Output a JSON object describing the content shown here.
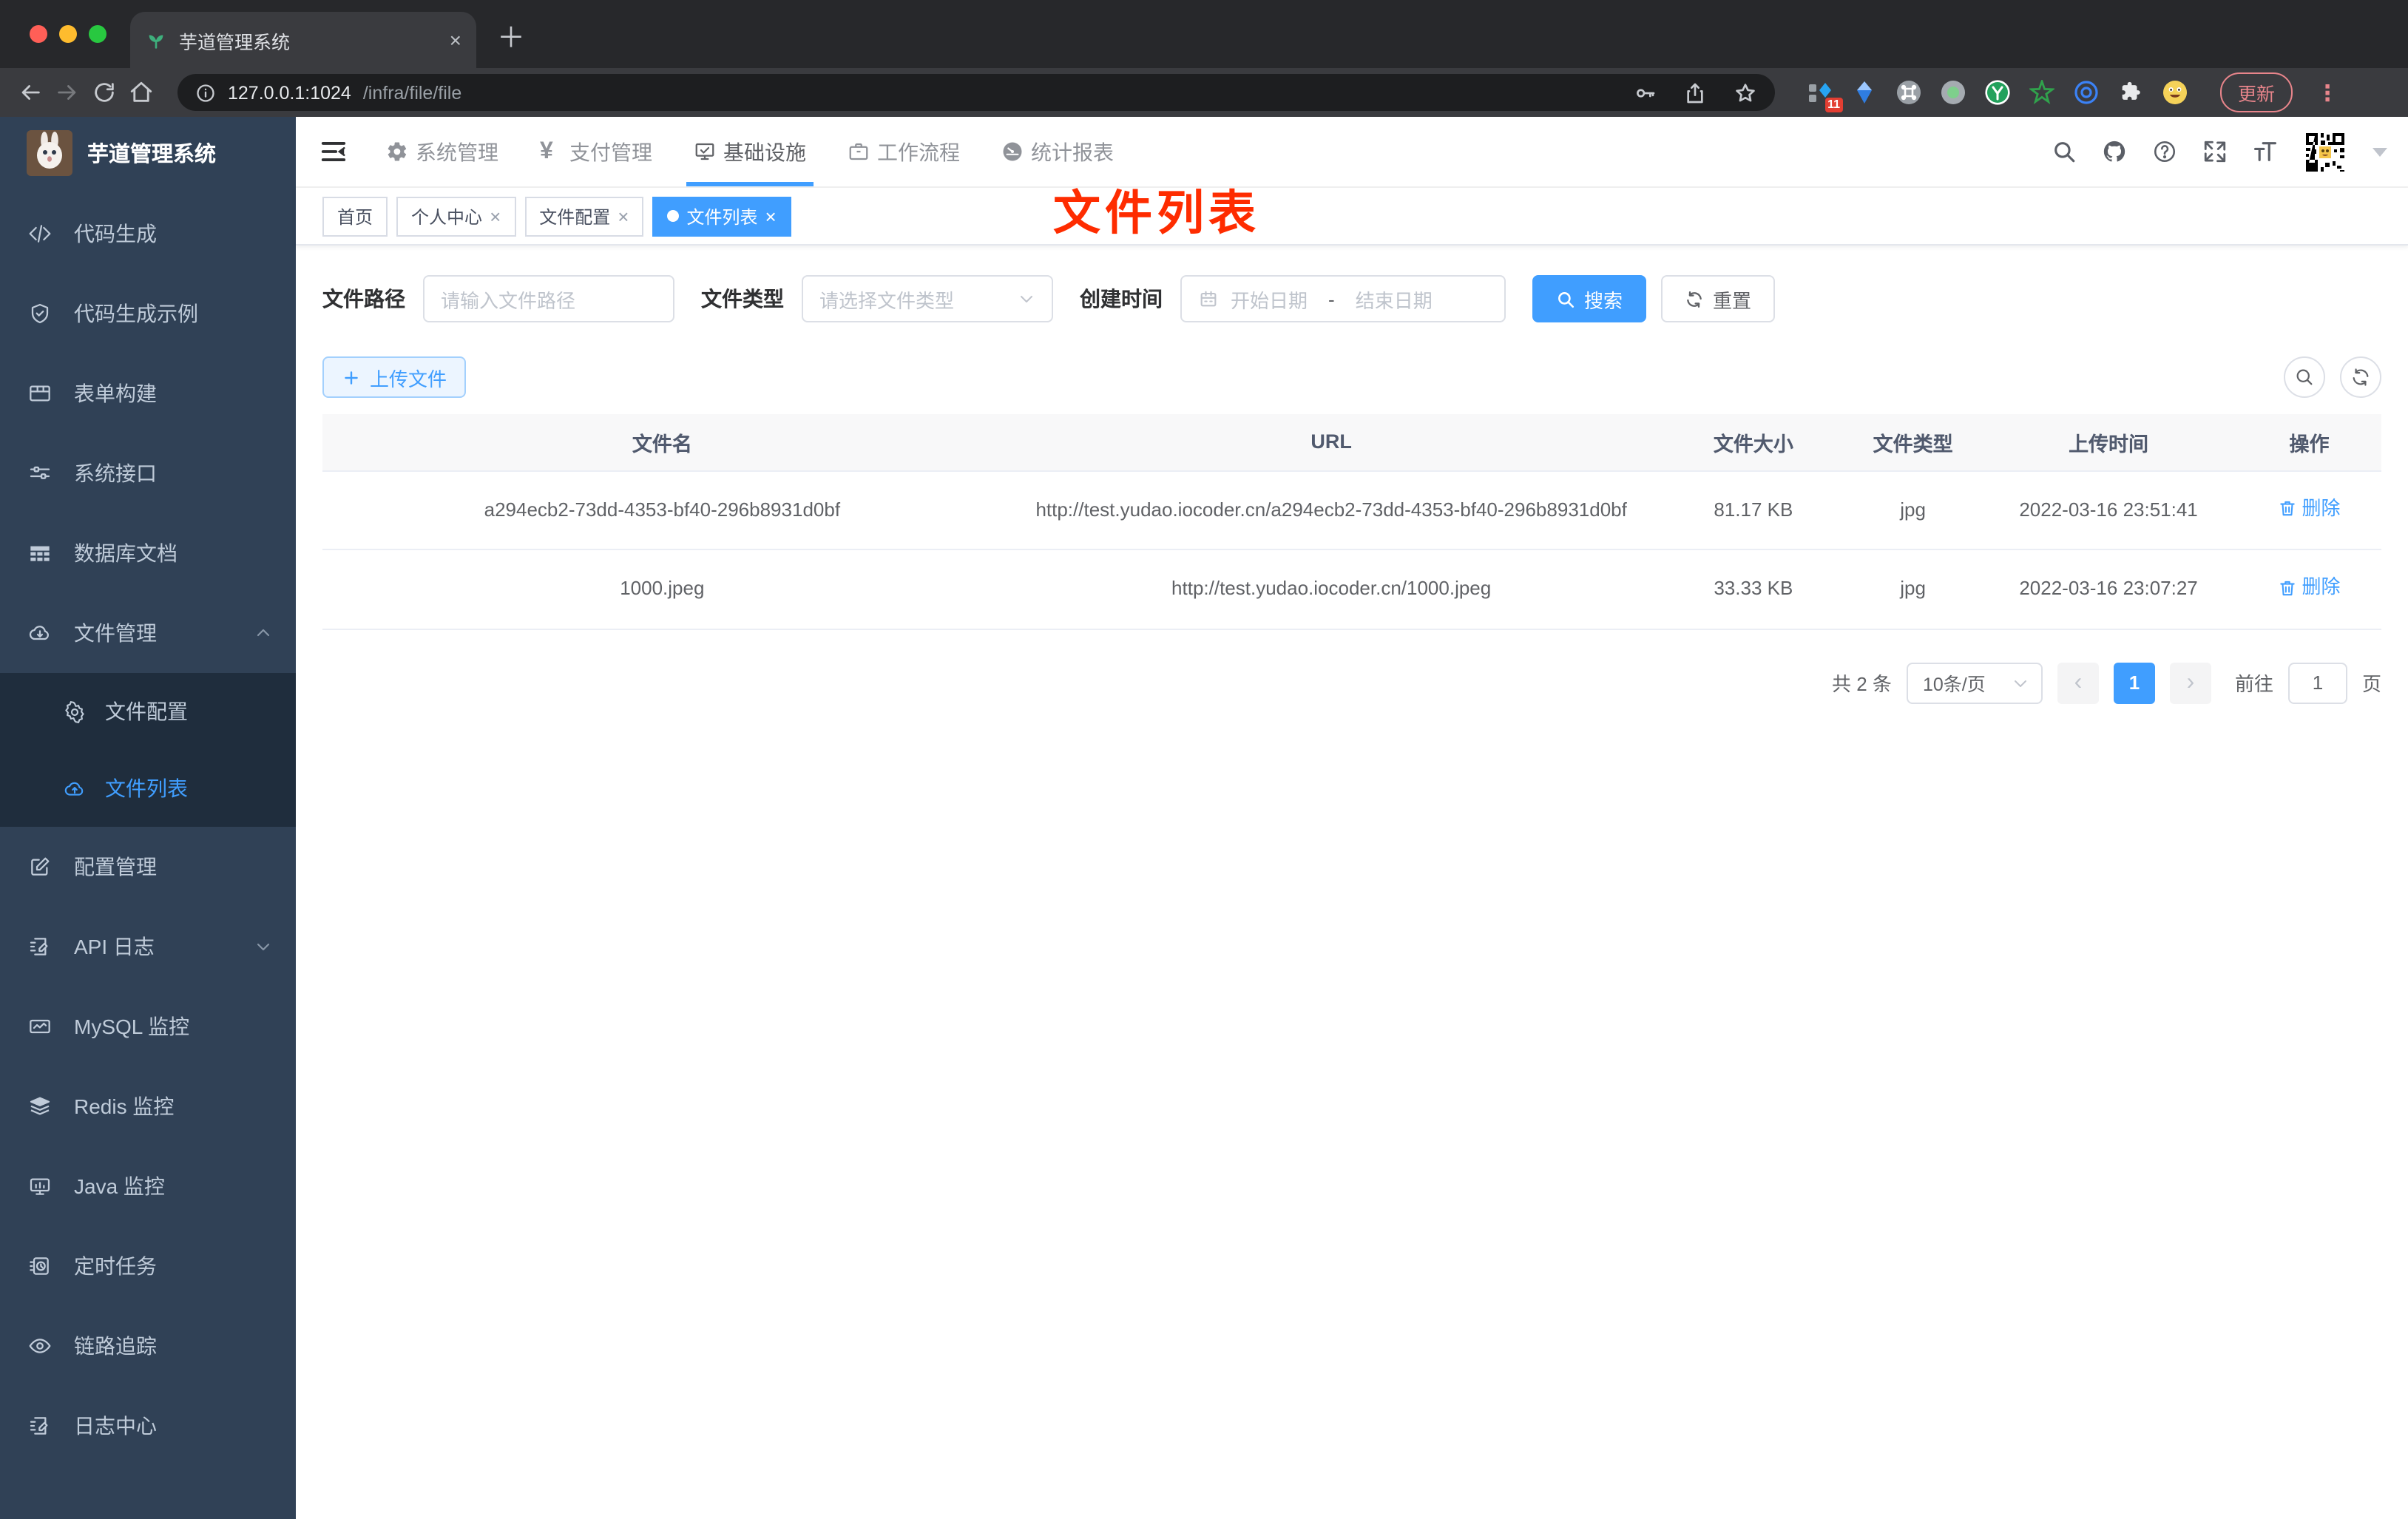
{
  "browser": {
    "tab_title": "芋道管理系统",
    "url_host": "127.0.0.1:1024",
    "url_path": "/infra/file/file",
    "update_label": "更新",
    "extension_badge": "11"
  },
  "header": {
    "nav": [
      {
        "label": "系统管理"
      },
      {
        "label": "支付管理"
      },
      {
        "label": "基础设施"
      },
      {
        "label": "工作流程"
      },
      {
        "label": "统计报表"
      }
    ]
  },
  "sidebar": {
    "title": "芋道管理系统",
    "items": [
      {
        "label": "代码生成"
      },
      {
        "label": "代码生成示例"
      },
      {
        "label": "表单构建"
      },
      {
        "label": "系统接口"
      },
      {
        "label": "数据库文档"
      },
      {
        "label": "文件管理"
      }
    ],
    "sub_items": [
      {
        "label": "文件配置"
      },
      {
        "label": "文件列表"
      }
    ],
    "bottom_items": [
      {
        "label": "配置管理"
      },
      {
        "label": "API 日志"
      },
      {
        "label": "MySQL 监控"
      },
      {
        "label": "Redis 监控"
      },
      {
        "label": "Java 监控"
      },
      {
        "label": "定时任务"
      },
      {
        "label": "链路追踪"
      },
      {
        "label": "日志中心"
      }
    ]
  },
  "tags": [
    {
      "label": "首页"
    },
    {
      "label": "个人中心"
    },
    {
      "label": "文件配置"
    },
    {
      "label": "文件列表"
    }
  ],
  "annotation": {
    "text": "文件列表",
    "color": "#fe2c00"
  },
  "filters": {
    "path_label": "文件路径",
    "path_placeholder": "请输入文件路径",
    "type_label": "文件类型",
    "type_placeholder": "请选择文件类型",
    "date_label": "创建时间",
    "date_start_placeholder": "开始日期",
    "date_separator": "-",
    "date_end_placeholder": "结束日期",
    "search_label": "搜索",
    "reset_label": "重置"
  },
  "toolbar": {
    "upload_label": "上传文件"
  },
  "table": {
    "headers": [
      "文件名",
      "URL",
      "文件大小",
      "文件类型",
      "上传时间",
      "操作"
    ],
    "rows": [
      {
        "name": "a294ecb2-73dd-4353-bf40-296b8931d0bf",
        "url": "http://test.yudao.iocoder.cn/a294ecb2-73dd-4353-bf40-296b8931d0bf",
        "size": "81.17 KB",
        "type": "jpg",
        "time": "2022-03-16 23:51:41",
        "action": "删除"
      },
      {
        "name": "1000.jpeg",
        "url": "http://test.yudao.iocoder.cn/1000.jpeg",
        "size": "33.33 KB",
        "type": "jpg",
        "time": "2022-03-16 23:07:27",
        "action": "删除"
      }
    ]
  },
  "pagination": {
    "total": "共 2 条",
    "page_size": "10条/页",
    "current_page": "1",
    "goto_label": "前往",
    "goto_value": "1",
    "page_unit": "页"
  },
  "glyphs": {
    "yen": "¥",
    "close": "×",
    "plus": "＋",
    "prev": "‹",
    "next": "›",
    "dots": "⋮"
  }
}
